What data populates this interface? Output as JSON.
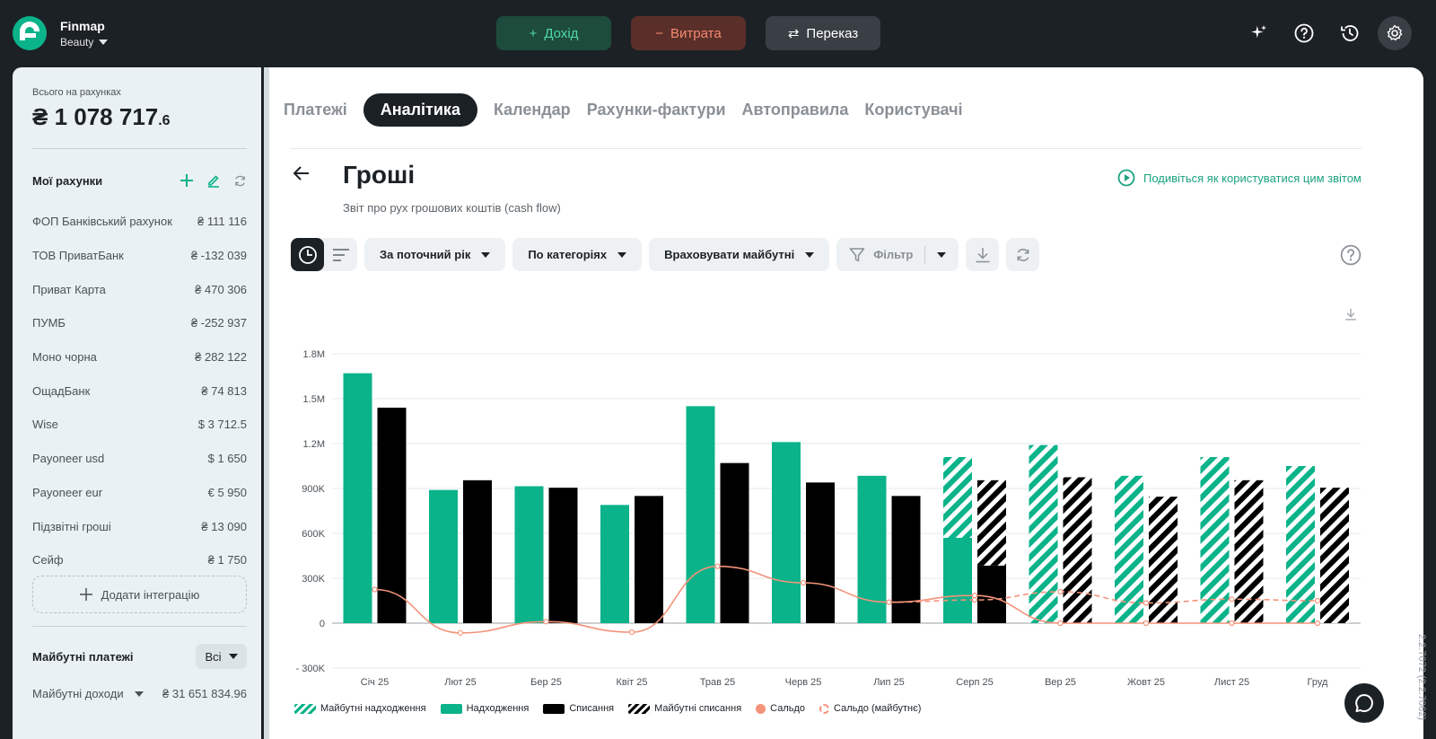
{
  "app": {
    "name": "Finmap",
    "workspace": "Beauty"
  },
  "top_actions": {
    "income": "Дохід",
    "expense": "Витрата",
    "transfer": "Переказ"
  },
  "sidebar": {
    "total_label": "Всього на рахунках",
    "total_main": "₴ 1 078 717",
    "total_fraction": ".6",
    "accounts_title": "Мої рахунки",
    "accounts": [
      {
        "name": "ФОП Банківський рахунок",
        "amount": "₴ 111 116"
      },
      {
        "name": "ТОВ ПриватБанк",
        "amount": "₴ -132 039"
      },
      {
        "name": "Приват Карта",
        "amount": "₴ 470 306"
      },
      {
        "name": "ПУМБ",
        "amount": "₴ -252 937"
      },
      {
        "name": "Моно чорна",
        "amount": "₴ 282 122"
      },
      {
        "name": "ОщадБанк",
        "amount": "₴ 74 813"
      },
      {
        "name": "Wise",
        "amount": "$  3 712.5"
      },
      {
        "name": "Payoneer usd",
        "amount": "$  1 650"
      },
      {
        "name": "Payoneer eur",
        "amount": "€ 5 950"
      },
      {
        "name": "Підзвітні гроші",
        "amount": "₴ 13 090"
      },
      {
        "name": "Сейф",
        "amount": "₴ 1 750"
      }
    ],
    "add_integration": "Додати інтеграцію",
    "future_title": "Майбутні платежі",
    "future_filter": "Всі",
    "future_income_label": "Майбутні доходи",
    "future_income_amount": "₴ 31 651 834.96"
  },
  "tabs": [
    "Платежі",
    "Аналітика",
    "Календар",
    "Рахунки-фактури",
    "Автоправила",
    "Користувачі"
  ],
  "active_tab": "Аналітика",
  "report": {
    "title": "Гроші",
    "subtitle": "Звіт про рух грошових коштів (cash flow)",
    "howto_link": "Подивіться як користуватися цим звітом"
  },
  "toolbar": {
    "period": "За поточний рік",
    "grouping": "По категоріях",
    "future_mode": "Враховувати майбутні",
    "filter": "Фільтр"
  },
  "colors": {
    "income": "#0bb38a",
    "expense": "#000000",
    "balance": "#f4937a",
    "accent": "#1aa37f"
  },
  "chart_data": {
    "type": "bar",
    "categories": [
      "Січ 25",
      "Лют 25",
      "Бер 25",
      "Квіт 25",
      "Трав 25",
      "Черв 25",
      "Лип 25",
      "Серп 25",
      "Вер 25",
      "Жовт 25",
      "Лист 25",
      "Груд"
    ],
    "y_ticks": [
      "1.8M",
      "1.5M",
      "1.2M",
      "900K",
      "600K",
      "300K",
      "0",
      "- 300K"
    ],
    "ylim": [
      -300000,
      1800000
    ],
    "series": [
      {
        "name": "Надходження",
        "values": [
          1670000,
          890000,
          915000,
          790000,
          1450000,
          1210000,
          985000,
          570000,
          0,
          0,
          0,
          0
        ]
      },
      {
        "name": "Майбутні надходження",
        "values": [
          0,
          0,
          0,
          0,
          0,
          0,
          0,
          540000,
          1190000,
          985000,
          1110000,
          1050000
        ]
      },
      {
        "name": "Списання",
        "values": [
          1440000,
          955000,
          905000,
          850000,
          1070000,
          940000,
          850000,
          385000,
          0,
          0,
          0,
          0
        ]
      },
      {
        "name": "Майбутні списання",
        "values": [
          0,
          0,
          0,
          0,
          0,
          0,
          0,
          570000,
          975000,
          845000,
          955000,
          905000
        ]
      },
      {
        "name": "Сальдо",
        "values": [
          225000,
          -65000,
          10000,
          -60000,
          380000,
          270000,
          140000,
          185000,
          0,
          0,
          0,
          0
        ]
      },
      {
        "name": "Сальдо (майбутнє)",
        "values": [
          null,
          null,
          null,
          null,
          null,
          null,
          140000,
          155000,
          210000,
          135000,
          160000,
          150000
        ]
      }
    ]
  },
  "version": "2.2.7072 (2.2.7062)"
}
